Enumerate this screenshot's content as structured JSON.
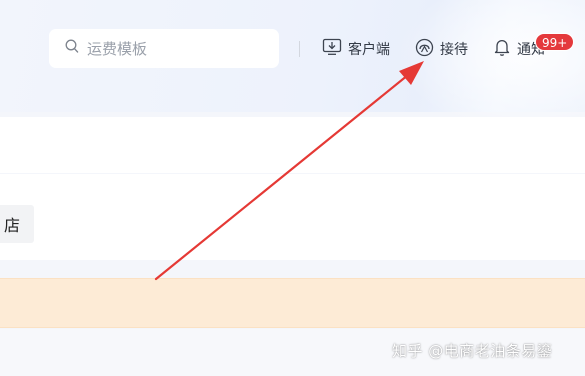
{
  "header": {
    "search": {
      "placeholder": "运费模板",
      "value": ""
    },
    "nav": {
      "client_label": "客户端",
      "reception_label": "接待",
      "notice_label": "通知",
      "notice_badge": "99+"
    }
  },
  "content": {
    "store_chip_label": "店"
  },
  "watermark": {
    "text": "知乎 @电商老油条易鎏"
  },
  "colors": {
    "annotation_arrow": "#e53935",
    "badge": "#e4393c",
    "notice_bar": "#fdebd6"
  },
  "icons": [
    "search-icon",
    "download-icon",
    "headset-icon",
    "bell-icon"
  ]
}
